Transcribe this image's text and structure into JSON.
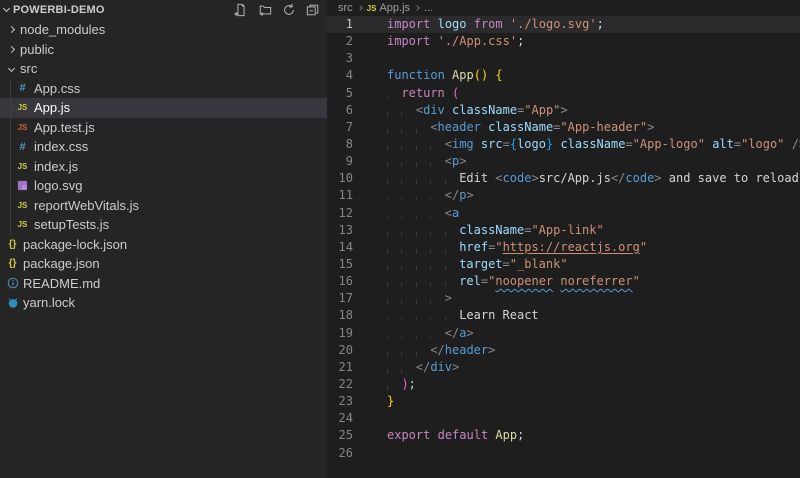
{
  "colors": {
    "sidebar_bg": "#252526",
    "editor_bg": "#1e1e1e",
    "selection_row": "#37373d",
    "keyword_purple": "#c586c0",
    "keyword_blue": "#569cd6",
    "string_orange": "#ce9178",
    "attribute_blue": "#9cdcfe",
    "function_yellow": "#dcdcaa",
    "bracket_gold": "#ffd700",
    "bracket_orchid": "#da70d6",
    "bracket_blue": "#179fff",
    "squiggle_blue": "#4e9dd6",
    "js_icon": "#cbcb41",
    "js_test_icon": "#d65d3e",
    "css_icon": "#519aba",
    "svg_icon": "#a074c4",
    "readme_icon": "#519aba",
    "yarn_icon": "#2c8ebb"
  },
  "sidebar": {
    "title": "POWERBI-DEMO",
    "actions": [
      {
        "name": "new-file",
        "icon": "new-file-icon"
      },
      {
        "name": "new-folder",
        "icon": "new-folder-icon"
      },
      {
        "name": "refresh",
        "icon": "refresh-icon"
      },
      {
        "name": "collapse-all",
        "icon": "collapse-all-icon"
      }
    ],
    "items": [
      {
        "label": "node_modules",
        "kind": "folder",
        "state": "collapsed",
        "indent": 0
      },
      {
        "label": "public",
        "kind": "folder",
        "state": "collapsed",
        "indent": 0
      },
      {
        "label": "src",
        "kind": "folder",
        "state": "expanded",
        "indent": 0
      },
      {
        "label": "App.css",
        "kind": "file",
        "icon": "css",
        "indent": 1
      },
      {
        "label": "App.js",
        "kind": "file",
        "icon": "js",
        "indent": 1,
        "selected": true
      },
      {
        "label": "App.test.js",
        "kind": "file",
        "icon": "js-test",
        "indent": 1
      },
      {
        "label": "index.css",
        "kind": "file",
        "icon": "css",
        "indent": 1
      },
      {
        "label": "index.js",
        "kind": "file",
        "icon": "js",
        "indent": 1
      },
      {
        "label": "logo.svg",
        "kind": "file",
        "icon": "svg",
        "indent": 1
      },
      {
        "label": "reportWebVitals.js",
        "kind": "file",
        "icon": "js",
        "indent": 1
      },
      {
        "label": "setupTests.js",
        "kind": "file",
        "icon": "js",
        "indent": 1
      },
      {
        "label": "package-lock.json",
        "kind": "file",
        "icon": "json",
        "indent": 0
      },
      {
        "label": "package.json",
        "kind": "file",
        "icon": "json",
        "indent": 0
      },
      {
        "label": "README.md",
        "kind": "file",
        "icon": "readme",
        "indent": 0
      },
      {
        "label": "yarn.lock",
        "kind": "file",
        "icon": "yarn",
        "indent": 0
      }
    ]
  },
  "editor": {
    "breadcrumb": [
      {
        "label": "src"
      },
      {
        "label": "App.js",
        "icon": "js"
      },
      {
        "label": "..."
      }
    ],
    "active_line": 1,
    "lines": [
      {
        "n": 1,
        "i": 0,
        "t": [
          [
            "kp",
            "import"
          ],
          [
            "tx",
            " "
          ],
          [
            "vb",
            "logo"
          ],
          [
            "tx",
            " "
          ],
          [
            "kp",
            "from"
          ],
          [
            "tx",
            " "
          ],
          [
            "st",
            "'./logo.svg'"
          ],
          [
            "tx",
            ";"
          ]
        ]
      },
      {
        "n": 2,
        "i": 0,
        "t": [
          [
            "kp",
            "import"
          ],
          [
            "tx",
            " "
          ],
          [
            "st",
            "'./App.css'"
          ],
          [
            "tx",
            ";"
          ]
        ]
      },
      {
        "n": 3,
        "i": 0,
        "t": []
      },
      {
        "n": 4,
        "i": 0,
        "t": [
          [
            "kb",
            "function"
          ],
          [
            "tx",
            " "
          ],
          [
            "fn",
            "App"
          ],
          [
            "b1",
            "()"
          ],
          [
            "tx",
            " "
          ],
          [
            "b1",
            "{"
          ]
        ]
      },
      {
        "n": 5,
        "i": 2,
        "t": [
          [
            "kp",
            "return"
          ],
          [
            "tx",
            " "
          ],
          [
            "b2",
            "("
          ]
        ]
      },
      {
        "n": 6,
        "i": 4,
        "t": [
          [
            "pu",
            "<"
          ],
          [
            "kb",
            "div"
          ],
          [
            "tx",
            " "
          ],
          [
            "at",
            "className"
          ],
          [
            "pu",
            "="
          ],
          [
            "st",
            "\"App\""
          ],
          [
            "pu",
            ">"
          ]
        ]
      },
      {
        "n": 7,
        "i": 6,
        "t": [
          [
            "pu",
            "<"
          ],
          [
            "kb",
            "header"
          ],
          [
            "tx",
            " "
          ],
          [
            "at",
            "className"
          ],
          [
            "pu",
            "="
          ],
          [
            "st",
            "\"App-header\""
          ],
          [
            "pu",
            ">"
          ]
        ]
      },
      {
        "n": 8,
        "i": 8,
        "t": [
          [
            "pu",
            "<"
          ],
          [
            "kb",
            "img"
          ],
          [
            "tx",
            " "
          ],
          [
            "at",
            "src"
          ],
          [
            "pu",
            "="
          ],
          [
            "b3",
            "{"
          ],
          [
            "vb",
            "logo"
          ],
          [
            "b3",
            "}"
          ],
          [
            "tx",
            " "
          ],
          [
            "at",
            "className"
          ],
          [
            "pu",
            "="
          ],
          [
            "st",
            "\"App-logo\""
          ],
          [
            "tx",
            " "
          ],
          [
            "at",
            "alt"
          ],
          [
            "pu",
            "="
          ],
          [
            "st",
            "\"logo\""
          ],
          [
            "tx",
            " "
          ],
          [
            "pu",
            "/>"
          ]
        ]
      },
      {
        "n": 9,
        "i": 8,
        "t": [
          [
            "pu",
            "<"
          ],
          [
            "kb",
            "p"
          ],
          [
            "pu",
            ">"
          ]
        ]
      },
      {
        "n": 10,
        "i": 10,
        "t": [
          [
            "tx",
            "Edit "
          ],
          [
            "pu",
            "<"
          ],
          [
            "kb",
            "code"
          ],
          [
            "pu",
            ">"
          ],
          [
            "tx",
            "src/App.js"
          ],
          [
            "pu",
            "</"
          ],
          [
            "kb",
            "code"
          ],
          [
            "pu",
            ">"
          ],
          [
            "tx",
            " and save to reload."
          ]
        ]
      },
      {
        "n": 11,
        "i": 8,
        "t": [
          [
            "pu",
            "</"
          ],
          [
            "kb",
            "p"
          ],
          [
            "pu",
            ">"
          ]
        ]
      },
      {
        "n": 12,
        "i": 8,
        "t": [
          [
            "pu",
            "<"
          ],
          [
            "kb",
            "a"
          ]
        ]
      },
      {
        "n": 13,
        "i": 10,
        "t": [
          [
            "at",
            "className"
          ],
          [
            "pu",
            "="
          ],
          [
            "st",
            "\"App-link\""
          ]
        ]
      },
      {
        "n": 14,
        "i": 10,
        "t": [
          [
            "at",
            "href"
          ],
          [
            "pu",
            "="
          ],
          [
            "st",
            "\""
          ],
          [
            "stu",
            "https://reactjs.org"
          ],
          [
            "st",
            "\""
          ]
        ]
      },
      {
        "n": 15,
        "i": 10,
        "t": [
          [
            "at",
            "target"
          ],
          [
            "pu",
            "="
          ],
          [
            "st",
            "\"_blank\""
          ]
        ]
      },
      {
        "n": 16,
        "i": 10,
        "t": [
          [
            "at",
            "rel"
          ],
          [
            "pu",
            "="
          ],
          [
            "st",
            "\""
          ],
          [
            "sq",
            "noopener"
          ],
          [
            "st",
            " "
          ],
          [
            "sq",
            "noreferrer"
          ],
          [
            "st",
            "\""
          ]
        ]
      },
      {
        "n": 17,
        "i": 8,
        "t": [
          [
            "pu",
            ">"
          ]
        ]
      },
      {
        "n": 18,
        "i": 10,
        "t": [
          [
            "tx",
            "Learn React"
          ]
        ]
      },
      {
        "n": 19,
        "i": 8,
        "t": [
          [
            "pu",
            "</"
          ],
          [
            "kb",
            "a"
          ],
          [
            "pu",
            ">"
          ]
        ]
      },
      {
        "n": 20,
        "i": 6,
        "t": [
          [
            "pu",
            "</"
          ],
          [
            "kb",
            "header"
          ],
          [
            "pu",
            ">"
          ]
        ]
      },
      {
        "n": 21,
        "i": 4,
        "t": [
          [
            "pu",
            "</"
          ],
          [
            "kb",
            "div"
          ],
          [
            "pu",
            ">"
          ]
        ]
      },
      {
        "n": 22,
        "i": 2,
        "t": [
          [
            "b2",
            ")"
          ],
          [
            "tx",
            ";"
          ]
        ]
      },
      {
        "n": 23,
        "i": 0,
        "t": [
          [
            "b1",
            "}"
          ]
        ]
      },
      {
        "n": 24,
        "i": 0,
        "t": []
      },
      {
        "n": 25,
        "i": 0,
        "t": [
          [
            "kp",
            "export"
          ],
          [
            "tx",
            " "
          ],
          [
            "kp",
            "default"
          ],
          [
            "tx",
            " "
          ],
          [
            "fn",
            "App"
          ],
          [
            "tx",
            ";"
          ]
        ]
      },
      {
        "n": 26,
        "i": 0,
        "t": []
      }
    ]
  }
}
